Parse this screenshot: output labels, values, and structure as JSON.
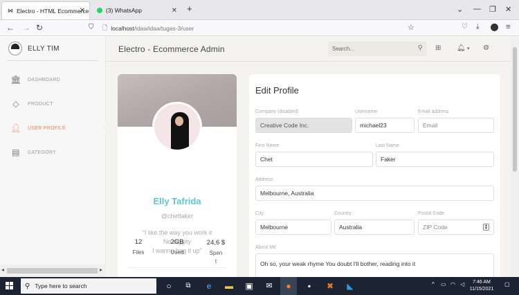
{
  "browser": {
    "tabs": [
      {
        "label": "Electro - HTML Ecommerce Ten",
        "icon": "bowtie-favicon-icon"
      },
      {
        "label": "(3) WhatsApp",
        "icon": "whatsapp-favicon-icon"
      }
    ],
    "url_host": "localhost",
    "url_path": "/idaa/idaa/tugas-3/user"
  },
  "sidebar": {
    "brand": "ELLY TIM",
    "items": [
      {
        "label": "DASHBOARD",
        "icon": "bank-icon",
        "active": false
      },
      {
        "label": "PRODUCT",
        "icon": "diamond-icon",
        "active": false
      },
      {
        "label": "USER PROFILE",
        "icon": "user-icon",
        "active": true
      },
      {
        "label": "CATEGORY",
        "icon": "grid-icon",
        "active": false
      }
    ]
  },
  "header": {
    "title": "Electro - Ecommerce Admin",
    "search_placeholder": "Search..."
  },
  "profile": {
    "name": "Elly Tafrida",
    "handle": "@chetfaker",
    "quote": [
      "\"I like the way you work it",
      "No diggity",
      "I wanna bag it up\""
    ],
    "stats": [
      {
        "value": "12",
        "label": "Files"
      },
      {
        "value": "2GB",
        "label": "Used"
      },
      {
        "value": "24,6 $",
        "label": "Spen t"
      }
    ]
  },
  "edit_profile": {
    "title": "Edit Profile",
    "company_label": "Company (disabled)",
    "company_value": "Creative Code Inc.",
    "username_label": "Username",
    "username_value": "michael23",
    "email_label": "Email address",
    "email_placeholder": "Email",
    "first_name_label": "First Name",
    "first_name_value": "Chet",
    "last_name_label": "Last Name",
    "last_name_value": "Faker",
    "address_label": "Address",
    "address_value": "Melbourne, Australia",
    "city_label": "City",
    "city_value": "Melbourne",
    "country_label": "Country",
    "country_value": "Australia",
    "postal_label": "Postal Code",
    "postal_placeholder": "ZIP Code",
    "about_label": "About Me",
    "about_value": "Oh so, your weak rhyme You doubt I'll bother, reading into it"
  },
  "taskbar": {
    "search_text": "Type here to search",
    "time": "7:46 AM",
    "date": "11/15/2021"
  },
  "colors": {
    "accent": "#ee7b52",
    "name_color": "#5cc6d0",
    "page_bg": "#f4f3ef"
  }
}
